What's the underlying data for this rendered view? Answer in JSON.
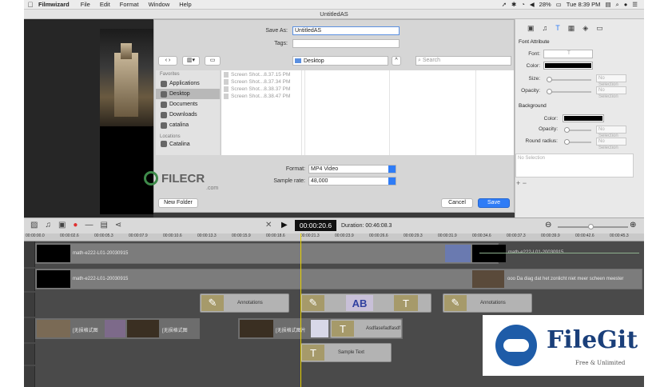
{
  "menubar": {
    "app_name": "Filmwizard",
    "items": [
      "File",
      "Edit",
      "Format",
      "Window",
      "Help"
    ],
    "battery": "28%",
    "clock": "Tue 8:39 PM"
  },
  "window": {
    "title": "UntitledAS"
  },
  "save_dialog": {
    "save_as_label": "Save As:",
    "save_as_value": "UntitledAS",
    "tags_label": "Tags:",
    "location": "Desktop",
    "search_placeholder": "Search",
    "favorites_header": "Favorites",
    "favorites": [
      "Applications",
      "Desktop",
      "Documents",
      "Downloads",
      "catalina"
    ],
    "locations_header": "Locations",
    "locations": [
      "Catalina"
    ],
    "files": [
      "Screen Shot...8.37.15 PM",
      "Screen Shot...8.37.34 PM",
      "Screen Shot...8.38.37 PM",
      "Screen Shot...8.38.47 PM"
    ],
    "format_label": "Format:",
    "format_value": "MP4 Video",
    "sample_rate_label": "Sample rate:",
    "sample_rate_value": "48,000",
    "new_folder_button": "New Folder",
    "cancel_button": "Cancel",
    "save_button": "Save"
  },
  "right_panel": {
    "font_attribute_header": "Font Attribute",
    "font_label": "Font:",
    "font_value": "T",
    "color_label": "Color:",
    "size_label": "Size:",
    "opacity_label": "Opacity:",
    "no_selection": "No Selection",
    "background_header": "Background",
    "bg_color_label": "Color:",
    "bg_opacity_label": "Opacity:",
    "round_radius_label": "Round radius:",
    "list_placeholder": "No Selection"
  },
  "timeline": {
    "current_time": "00:00:20.6",
    "duration": "Duration: 00:46:08.3",
    "ruler_ticks": [
      "00:00:00.0",
      "00:00:02.6",
      "00:00:05.3",
      "00:00:07.9",
      "00:00:10.6",
      "00:00:13.3",
      "00:00:15.9",
      "00:00:18.6",
      "00:00:21.3",
      "00:00:23.9",
      "00:00:26.6",
      "00:00:29.3",
      "00:00:31.9",
      "00:00:34.6",
      "00:00:37.3",
      "00:00:39.9",
      "00:00:42.6",
      "00:00:45.3"
    ],
    "track1_clip": "math-e222-L01-20030915",
    "track1_clip2": "math-e222-L01-20030915",
    "track2_clip": "math-e222-L01-20030915",
    "track2_clip2": "ooo Da diag dat het zonlicht niet meer scheen meester",
    "annotations_1": "Annotations",
    "annotations_2": "Annotations",
    "track4_label1": "[无损格式图",
    "track4_label2": "[无损格式图",
    "track4_label3": "[无损格式图片",
    "track4_text": "Asdfasefadfasdf",
    "sample_text": "Sample Text"
  },
  "watermarks": {
    "filecr": "FILECR",
    "filecr_sub": ".com",
    "filegit": "FileGit",
    "filegit_sub": "Free & Unlimited"
  }
}
